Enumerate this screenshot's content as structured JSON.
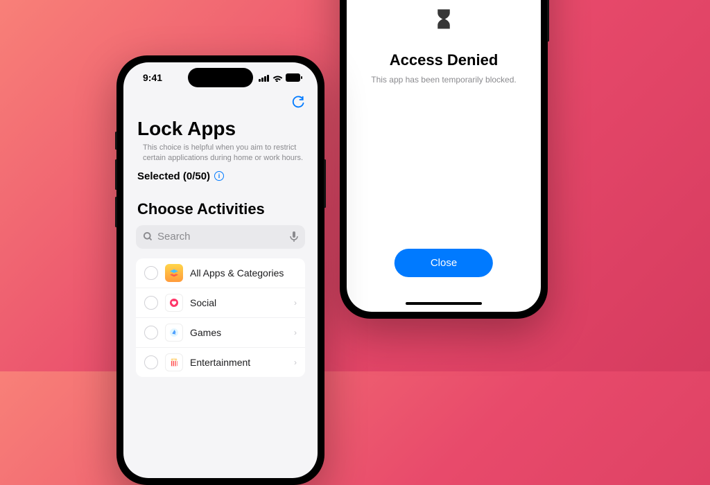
{
  "phoneLeft": {
    "statusBar": {
      "time": "9:41"
    },
    "header": {
      "title": "Lock Apps",
      "subtitle": "This choice is helpful when you aim to restrict certain applications during home or work hours."
    },
    "selected": {
      "label": "Selected (0/50)"
    },
    "activities": {
      "sectionTitle": "Choose Activities",
      "searchPlaceholder": "Search",
      "items": [
        {
          "label": "All Apps & Categories",
          "iconName": "stack-icon",
          "glyph": "≡"
        },
        {
          "label": "Social",
          "iconName": "social-icon",
          "glyph": "❤"
        },
        {
          "label": "Games",
          "iconName": "games-icon",
          "glyph": "🚀"
        },
        {
          "label": "Entertainment",
          "iconName": "entertainment-icon",
          "glyph": "🍿"
        }
      ]
    }
  },
  "phoneRight": {
    "denied": {
      "title": "Access Denied",
      "subtitle": "This app has been temporarily blocked.",
      "closeLabel": "Close"
    }
  }
}
